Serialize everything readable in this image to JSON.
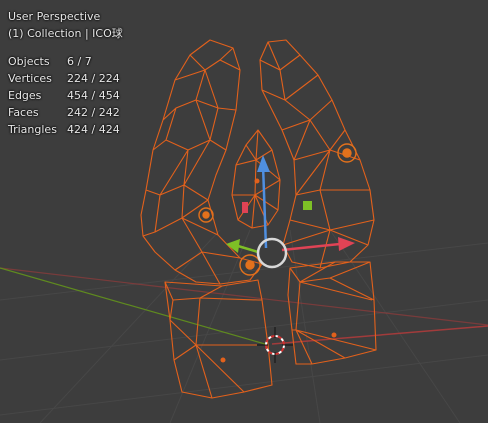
{
  "viewport": {
    "view_name": "User Perspective",
    "collection": "(1) Collection | ICO球"
  },
  "stats": [
    {
      "label": "Objects",
      "value": "6 / 7"
    },
    {
      "label": "Vertices",
      "value": "224 / 224"
    },
    {
      "label": "Edges",
      "value": "454 / 454"
    },
    {
      "label": "Faces",
      "value": "242 / 242"
    },
    {
      "label": "Triangles",
      "value": "424 / 424"
    }
  ],
  "colors": {
    "background": "#3d3d3d",
    "wire": "#e2611c",
    "grid": "#474747",
    "x_axis": "#a23b3b",
    "y_axis": "#5f8a1f",
    "gizmo_x": "#e04355",
    "gizmo_y": "#7ec026",
    "gizmo_z": "#4f8fe0",
    "gizmo_circle": "#d8d8d8"
  }
}
